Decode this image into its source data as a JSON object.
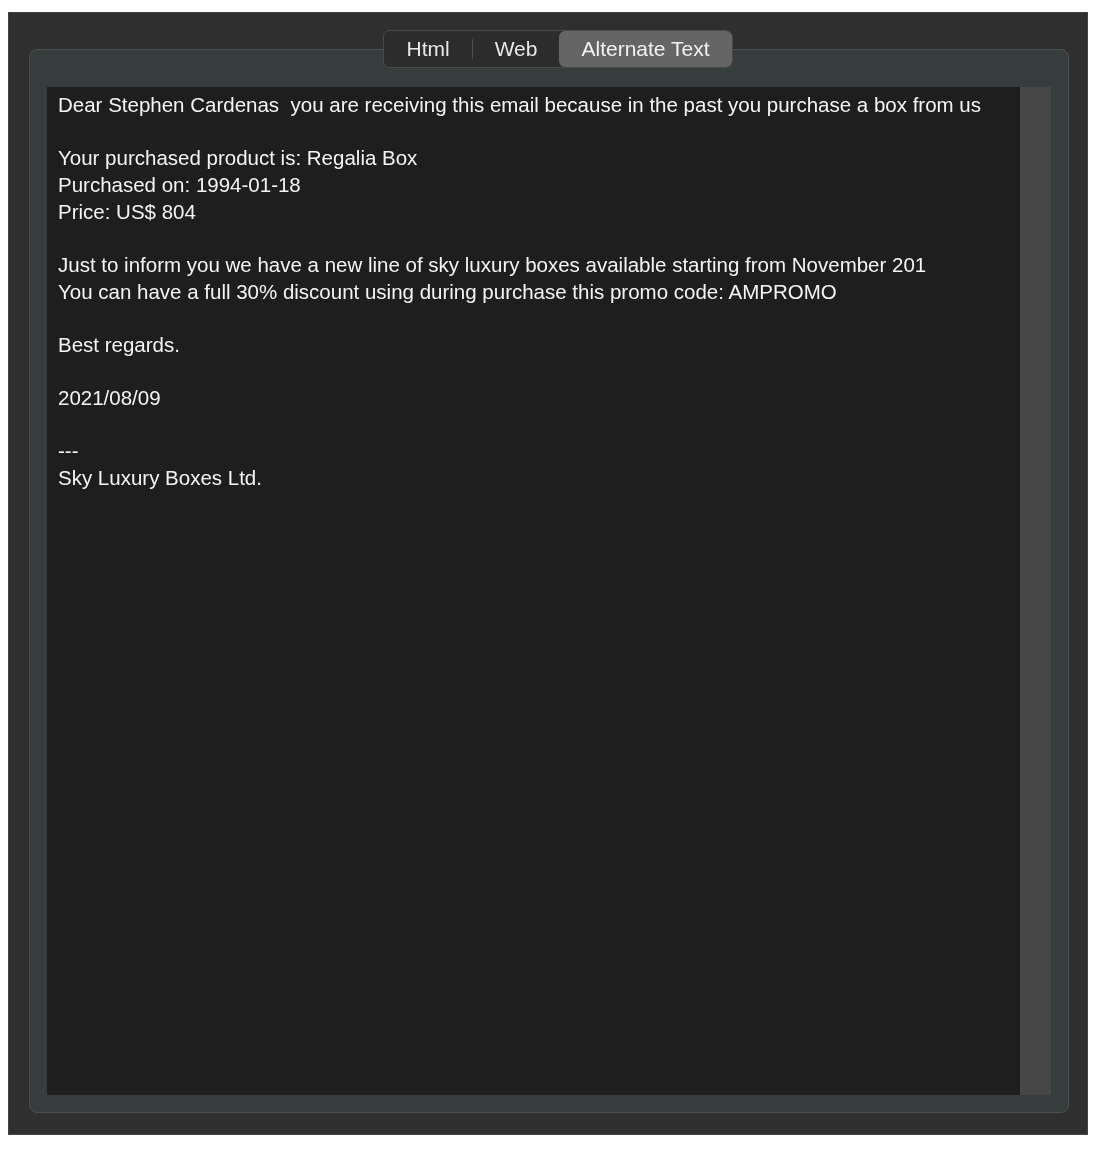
{
  "tabs": [
    {
      "label": "Html",
      "selected": false
    },
    {
      "label": "Web",
      "selected": false
    },
    {
      "label": "Alternate Text",
      "selected": true
    }
  ],
  "message": {
    "paragraphs": [
      [
        "Dear Stephen Cardenas  you are receiving this email because in the past you purchase a box from us"
      ],
      [
        "Your purchased product is: Regalia Box",
        "Purchased on: 1994-01-18",
        "Price: US$ 804"
      ],
      [
        "Just to inform you we have a new line of sky luxury boxes available starting from November 201",
        "You can have a full 30% discount using during purchase this promo code: AMPROMO"
      ],
      [
        "Best regards."
      ],
      [
        "2021/08/09"
      ],
      [
        "---",
        "Sky Luxury Boxes Ltd."
      ]
    ]
  }
}
